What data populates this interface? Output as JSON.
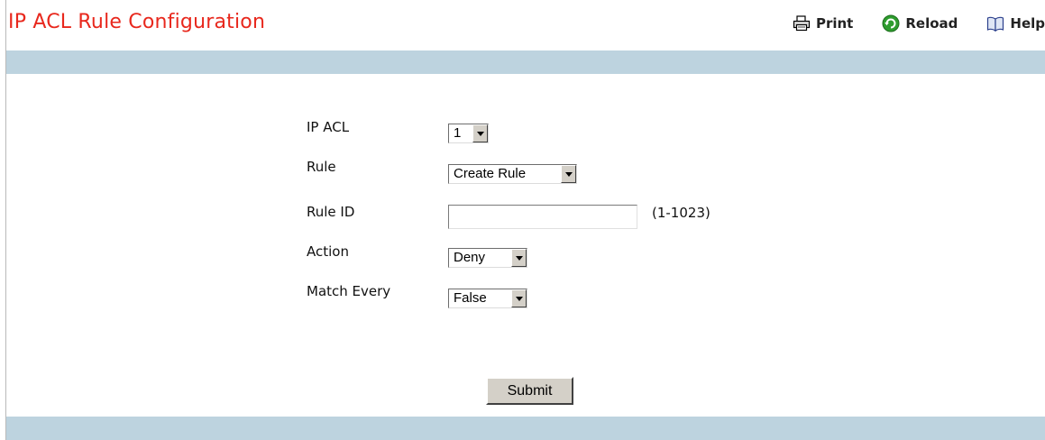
{
  "page": {
    "title": "IP ACL Rule Configuration"
  },
  "toolbar": {
    "print": "Print",
    "reload": "Reload",
    "help": "Help"
  },
  "form": {
    "ip_acl": {
      "label": "IP ACL",
      "value": "1"
    },
    "rule": {
      "label": "Rule",
      "value": "Create Rule"
    },
    "rule_id": {
      "label": "Rule ID",
      "value": "",
      "hint": "(1-1023)"
    },
    "action": {
      "label": "Action",
      "value": "Deny"
    },
    "match_every": {
      "label": "Match Every",
      "value": "False"
    },
    "submit": "Submit"
  },
  "colors": {
    "title": "#e8281d",
    "band": "#bdd3df",
    "control_face": "#d4d0c8"
  },
  "icons": {
    "print": "printer-icon",
    "reload": "reload-icon",
    "help": "help-book-icon"
  }
}
